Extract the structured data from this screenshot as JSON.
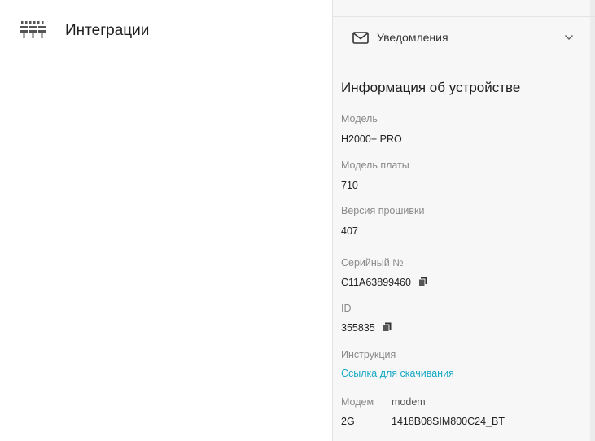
{
  "left_panel": {
    "item_label": "Интеграции",
    "item_icon": "integrations-icon"
  },
  "notifications": {
    "label": "Уведомления",
    "icon": "envelope-icon",
    "expand_icon": "chevron-down-icon"
  },
  "device_info": {
    "title": "Информация об устройстве",
    "model_label": "Модель",
    "model_value": "H2000+ PRO",
    "board_label": "Модель платы",
    "board_value": "710",
    "firmware_label": "Версия прошивки",
    "firmware_value": "407",
    "serial_label": "Серийный №",
    "serial_value": "C11A63899460",
    "id_label": "ID",
    "id_value": "355835",
    "manual_label": "Инструкция",
    "manual_link": "Ссылка для скачивания",
    "modem_label": "Модем",
    "modem_col_label": "modem",
    "modem_type": "2G",
    "modem_value": "1418B08SIM800C24_BT"
  },
  "colors": {
    "link": "#17a9c4",
    "panel_bg": "#f7f7f7",
    "label": "#8a8a8a"
  }
}
